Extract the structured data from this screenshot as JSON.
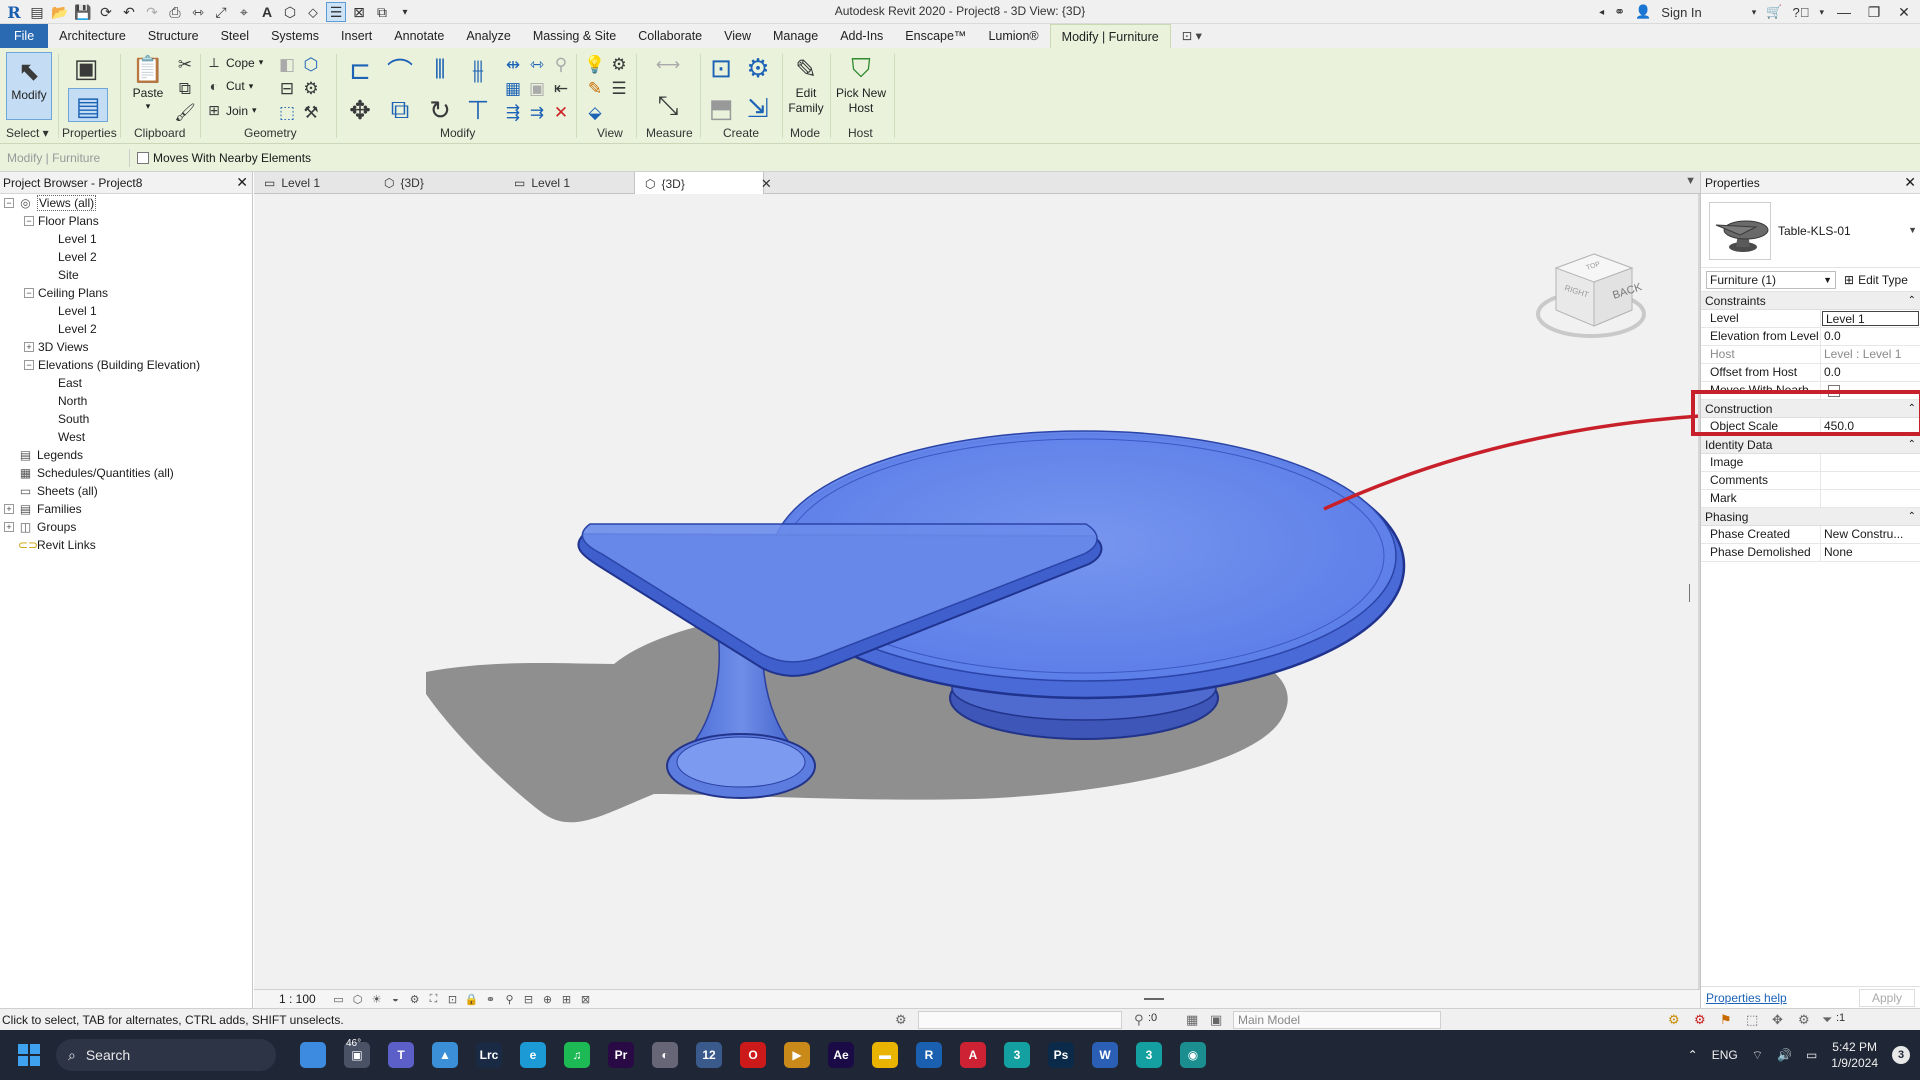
{
  "window": {
    "title": "Autodesk Revit 2020 - Project8 - 3D View: {3D}",
    "sign_in": "Sign In"
  },
  "ribbon_tabs": [
    "File",
    "Architecture",
    "Structure",
    "Steel",
    "Systems",
    "Insert",
    "Annotate",
    "Analyze",
    "Massing & Site",
    "Collaborate",
    "View",
    "Manage",
    "Add-Ins",
    "Enscape™",
    "Lumion®",
    "Modify | Furniture"
  ],
  "ribbon": {
    "modify_label": "Modify",
    "select_label": "Select ▾",
    "properties_label": "Properties",
    "paste_label": "Paste",
    "clipboard_label": "Clipboard",
    "cope_label": "Cope",
    "cut_label": "Cut",
    "join_label": "Join",
    "geometry_label": "Geometry",
    "modify_panel_label": "Modify",
    "view_label": "View",
    "measure_label": "Measure",
    "create_label": "Create",
    "edit_family_label": "Edit Family",
    "mode_label": "Mode",
    "pick_new_host_label": "Pick New Host",
    "host_label": "Host"
  },
  "options_bar": {
    "context": "Modify | Furniture",
    "moves_with_nearby": "Moves With Nearby Elements"
  },
  "project_browser": {
    "title": "Project Browser - Project8",
    "items": [
      {
        "label": "Views (all)",
        "level": 0,
        "toggle": "−",
        "icon": "views-icon",
        "glyph": "◎"
      },
      {
        "label": "Floor Plans",
        "level": 1,
        "toggle": "−"
      },
      {
        "label": "Level 1",
        "level": 2
      },
      {
        "label": "Level 2",
        "level": 2
      },
      {
        "label": "Site",
        "level": 2
      },
      {
        "label": "Ceiling Plans",
        "level": 1,
        "toggle": "−"
      },
      {
        "label": "Level 1",
        "level": 2
      },
      {
        "label": "Level 2",
        "level": 2
      },
      {
        "label": "3D Views",
        "level": 1,
        "toggle": "+"
      },
      {
        "label": "Elevations (Building Elevation)",
        "level": 1,
        "toggle": "−"
      },
      {
        "label": "East",
        "level": 2
      },
      {
        "label": "North",
        "level": 2
      },
      {
        "label": "South",
        "level": 2
      },
      {
        "label": "West",
        "level": 2
      },
      {
        "label": "Legends",
        "level": 0,
        "icon": "legends-icon",
        "glyph": "▤"
      },
      {
        "label": "Schedules/Quantities (all)",
        "level": 0,
        "icon": "schedules-icon",
        "glyph": "▦"
      },
      {
        "label": "Sheets (all)",
        "level": 0,
        "toggle": "",
        "icon": "sheets-icon",
        "glyph": "▭"
      },
      {
        "label": "Families",
        "level": 0,
        "toggle": "+",
        "icon": "families-icon",
        "glyph": "▤"
      },
      {
        "label": "Groups",
        "level": 0,
        "toggle": "+",
        "icon": "groups-icon",
        "glyph": "◫"
      },
      {
        "label": "Revit Links",
        "level": 0,
        "icon": "links-icon",
        "glyph": "⊂⊃"
      }
    ]
  },
  "view_tabs": [
    {
      "label": "Level 1",
      "icon": "floor-plan-icon"
    },
    {
      "label": "{3D}",
      "icon": "3d-view-icon"
    },
    {
      "label": "Level 1",
      "icon": "floor-plan-icon"
    },
    {
      "label": "{3D}",
      "icon": "3d-view-icon",
      "active": true
    }
  ],
  "viewcube": {
    "face": "BACK",
    "side_left": "RIGHT",
    "top": "TOP"
  },
  "view_control": {
    "scale": "1 : 100"
  },
  "properties": {
    "title": "Properties",
    "type_name": "Table-KLS-01",
    "instance_filter": "Furniture (1)",
    "edit_type": "Edit Type",
    "groups": [
      {
        "name": "Constraints",
        "rows": [
          {
            "name": "Level",
            "value": "Level 1",
            "editing": true
          },
          {
            "name": "Elevation from Level",
            "value": "0.0"
          },
          {
            "name": "Host",
            "value": "Level : Level 1",
            "readonly": true
          },
          {
            "name": "Offset from Host",
            "value": "0.0"
          },
          {
            "name": "Moves With Nearb...",
            "value": "",
            "checkbox": true
          }
        ]
      },
      {
        "name": "Construction",
        "rows": [
          {
            "name": "Object Scale",
            "value": "450.0"
          }
        ]
      },
      {
        "name": "Identity Data",
        "rows": [
          {
            "name": "Image",
            "value": ""
          },
          {
            "name": "Comments",
            "value": ""
          },
          {
            "name": "Mark",
            "value": ""
          }
        ]
      },
      {
        "name": "Phasing",
        "rows": [
          {
            "name": "Phase Created",
            "value": "New Constru..."
          },
          {
            "name": "Phase Demolished",
            "value": "None"
          }
        ]
      }
    ],
    "help_link": "Properties help",
    "apply": "Apply"
  },
  "status_bar": {
    "message": "Click to select, TAB for alternates, CTRL adds, SHIFT unselects.",
    "selection_count": ":0",
    "model": "Main Model",
    "filter_count": ":1"
  },
  "taskbar": {
    "search": "Search",
    "weather": "46°",
    "language": "ENG",
    "time": "5:42 PM",
    "date": "1/9/2024",
    "notifications": "3",
    "apps": [
      {
        "name": "weather-icon",
        "label": "",
        "color": "#3d8be0"
      },
      {
        "name": "task-view-icon",
        "label": "▣",
        "color": "#4a5266"
      },
      {
        "name": "teams-icon",
        "label": "T",
        "color": "#5b5fc7"
      },
      {
        "name": "photos-icon",
        "label": "▲",
        "color": "#3a8fd6"
      },
      {
        "name": "lightroom-icon",
        "label": "Lrc",
        "color": "#1a2a45"
      },
      {
        "name": "edge-icon",
        "label": "e",
        "color": "#1c9ad6"
      },
      {
        "name": "spotify-icon",
        "label": "♫",
        "color": "#1db954"
      },
      {
        "name": "premiere-icon",
        "label": "Pr",
        "color": "#2a0a45"
      },
      {
        "name": "browser-icon",
        "label": "◐",
        "color": "#667"
      },
      {
        "name": "calendar-icon",
        "label": "12",
        "color": "#3b5a8c"
      },
      {
        "name": "opera-icon",
        "label": "O",
        "color": "#cc1a1a"
      },
      {
        "name": "media-icon",
        "label": "▶",
        "color": "#c98a1a"
      },
      {
        "name": "after-effects-icon",
        "label": "Ae",
        "color": "#1a0a45"
      },
      {
        "name": "explorer-icon",
        "label": "▬",
        "color": "#e8b400"
      },
      {
        "name": "revit-icon",
        "label": "R",
        "color": "#1b5fb0"
      },
      {
        "name": "autocad-icon",
        "label": "A",
        "color": "#cc2233"
      },
      {
        "name": "3dsmax-icon",
        "label": "3",
        "color": "#14a0a0"
      },
      {
        "name": "photoshop-icon",
        "label": "Ps",
        "color": "#0b2a4a"
      },
      {
        "name": "word-icon",
        "label": "W",
        "color": "#2b5fb5"
      },
      {
        "name": "3dsmax2-icon",
        "label": "3",
        "color": "#14a0a0"
      },
      {
        "name": "globe-icon",
        "label": "◉",
        "color": "#1b8f8f"
      }
    ]
  }
}
